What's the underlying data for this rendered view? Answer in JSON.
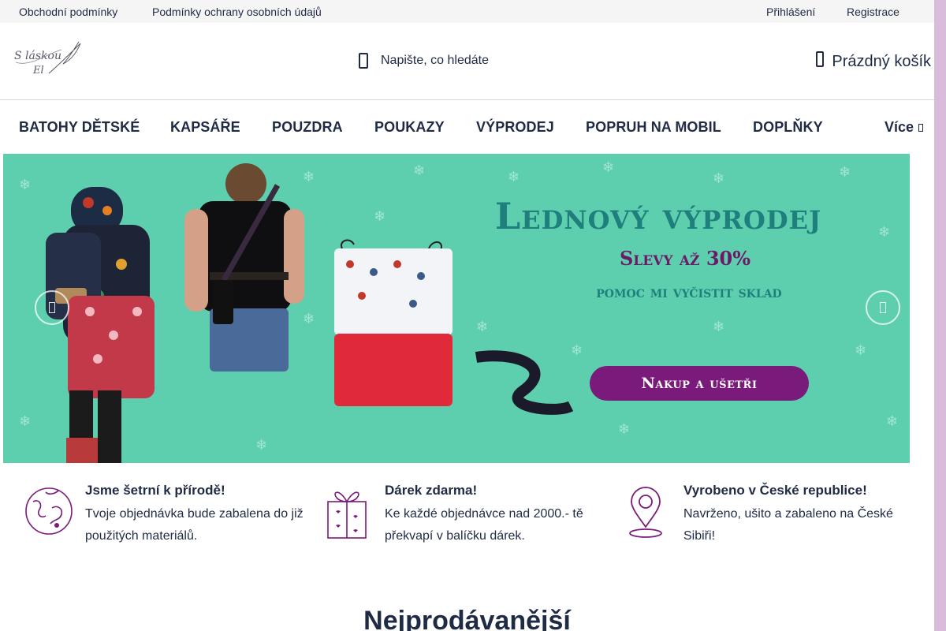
{
  "topbar": {
    "links_left": [
      "Obchodní podmínky",
      "Podmínky ochrany osobních údajů"
    ],
    "login": "Přihlášení",
    "register": "Registrace"
  },
  "header": {
    "logo_text_1": "S láskou",
    "logo_text_2": "El",
    "search_placeholder": "Napište, co hledáte",
    "cart_label": "Prázdný košík"
  },
  "nav": {
    "items": [
      "BATOHY DĚTSKÉ",
      "KAPSÁŘE",
      "POUZDRA",
      "POUKAZY",
      "VÝPRODEJ",
      "POPRUH NA MOBIL",
      "DOPLŇKY"
    ],
    "more_label": "Více"
  },
  "banner": {
    "headline": "Lednový výprodej",
    "subline": "Slevy až 30%",
    "subline2": "pomoc mi vyčistit sklad",
    "cta": "Nakup a ušetři",
    "background_color": "#5ecfae",
    "cta_color": "#7a1a7a"
  },
  "features": [
    {
      "title": "Jsme šetrní k přírodě!",
      "description": "Tvoje objednávka bude zabalena do již použitých materiálů.",
      "icon": "earth-icon"
    },
    {
      "title": "Dárek zdarma!",
      "description": "Ke každé objednávce nad 2000.- tě překvapí v balíčku dárek.",
      "icon": "gift-icon"
    },
    {
      "title": "Vyrobeno v České republice!",
      "description": "Navrženo, ušito a zabaleno na České Sibiři!",
      "icon": "location-pin-icon"
    }
  ],
  "section_title": "Nejprodávanější",
  "colors": {
    "accent": "#7a1a7a",
    "text": "#1f2a44",
    "page_side": "#d9bcdc"
  }
}
